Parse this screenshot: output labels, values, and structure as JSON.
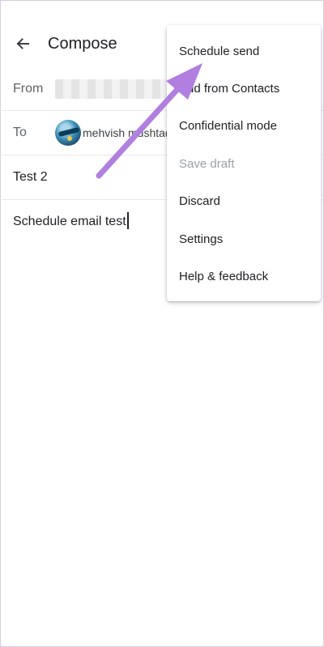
{
  "appbar": {
    "title": "Compose",
    "back_icon": "arrow-left-icon"
  },
  "from": {
    "label": "From"
  },
  "to": {
    "label": "To",
    "recipient_name": "mehvish mushtaq"
  },
  "subject": {
    "value": "Test 2"
  },
  "body": {
    "value": "Schedule email test"
  },
  "menu": {
    "items": [
      {
        "label": "Schedule send",
        "disabled": false
      },
      {
        "label": "Add from Contacts",
        "disabled": false
      },
      {
        "label": "Confidential mode",
        "disabled": false
      },
      {
        "label": "Save draft",
        "disabled": true
      },
      {
        "label": "Discard",
        "disabled": false
      },
      {
        "label": "Settings",
        "disabled": false
      },
      {
        "label": "Help & feedback",
        "disabled": false
      }
    ]
  },
  "colors": {
    "annotation_arrow": "#b07fe0",
    "disabled_text": "#9aa0a6",
    "primary_text": "#202124"
  }
}
